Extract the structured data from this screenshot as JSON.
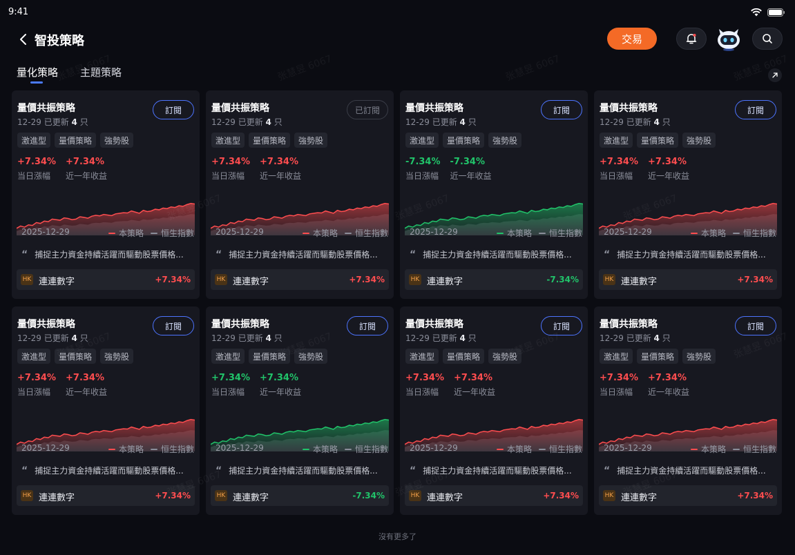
{
  "status_bar": {
    "time": "9:41"
  },
  "header": {
    "title": "智投策略",
    "trade_label": "交易"
  },
  "tabs": [
    {
      "label": "量化策略",
      "active": true
    },
    {
      "label": "主題策略",
      "active": false
    }
  ],
  "colors": {
    "accent": "#4b7bff",
    "up": "#ff4d4f",
    "down": "#21c46a",
    "trade": "#f46a26",
    "hk_badge": "#f3a04a"
  },
  "legend": {
    "strategy": "本策略",
    "index": "恒生指數"
  },
  "cards": [
    {
      "title": "量價共振策略",
      "date": "12-29",
      "updated_label": "已更新",
      "count": "4",
      "unit": "只",
      "subscribe_label": "訂閱",
      "subscribed": false,
      "tags": [
        "激進型",
        "量價策略",
        "強勢股"
      ],
      "daily": "+7.34%",
      "daily_label": "当日漲幅",
      "yearly": "+7.34%",
      "yearly_label": "近一年收益",
      "trend": "up",
      "chart_date": "2025-12-29",
      "desc": "捕捉主力資金持續活躍而驅動股票價格...",
      "stock_market": "HK",
      "stock_name": "連連數字",
      "stock_change": "+7.34%"
    },
    {
      "title": "量價共振策略",
      "date": "12-29",
      "updated_label": "已更新",
      "count": "4",
      "unit": "只",
      "subscribe_label": "已訂閱",
      "subscribed": true,
      "tags": [
        "激進型",
        "量價策略",
        "強勢股"
      ],
      "daily": "+7.34%",
      "daily_label": "当日漲幅",
      "yearly": "+7.34%",
      "yearly_label": "近一年收益",
      "trend": "up",
      "chart_date": "2025-12-29",
      "desc": "捕捉主力資金持續活躍而驅動股票價格...",
      "stock_market": "HK",
      "stock_name": "連連數字",
      "stock_change": "+7.34%"
    },
    {
      "title": "量價共振策略",
      "date": "12-29",
      "updated_label": "已更新",
      "count": "4",
      "unit": "只",
      "subscribe_label": "訂閱",
      "subscribed": false,
      "tags": [
        "激進型",
        "量價策略",
        "強勢股"
      ],
      "daily": "-7.34%",
      "daily_label": "当日漲幅",
      "yearly": "-7.34%",
      "yearly_label": "近一年收益",
      "trend": "down",
      "chart_date": "2025-12-29",
      "desc": "捕捉主力資金持續活躍而驅動股票價格...",
      "stock_market": "HK",
      "stock_name": "連連數字",
      "stock_change": "-7.34%"
    },
    {
      "title": "量價共振策略",
      "date": "12-29",
      "updated_label": "已更新",
      "count": "4",
      "unit": "只",
      "subscribe_label": "訂閱",
      "subscribed": false,
      "tags": [
        "激進型",
        "量價策略",
        "強勢股"
      ],
      "daily": "+7.34%",
      "daily_label": "当日漲幅",
      "yearly": "+7.34%",
      "yearly_label": "近一年收益",
      "trend": "up",
      "chart_date": "2025-12-29",
      "desc": "捕捉主力資金持續活躍而驅動股票價格...",
      "stock_market": "HK",
      "stock_name": "連連數字",
      "stock_change": "+7.34%"
    },
    {
      "title": "量價共振策略",
      "date": "12-29",
      "updated_label": "已更新",
      "count": "4",
      "unit": "只",
      "subscribe_label": "訂閱",
      "subscribed": false,
      "tags": [
        "激進型",
        "量價策略",
        "強勢股"
      ],
      "daily": "+7.34%",
      "daily_label": "当日漲幅",
      "yearly": "+7.34%",
      "yearly_label": "近一年收益",
      "trend": "up",
      "chart_date": "2025-12-29",
      "desc": "捕捉主力資金持續活躍而驅動股票價格...",
      "stock_market": "HK",
      "stock_name": "連連數字",
      "stock_change": "+7.34%"
    },
    {
      "title": "量價共振策略",
      "date": "12-29",
      "updated_label": "已更新",
      "count": "4",
      "unit": "只",
      "subscribe_label": "訂閱",
      "subscribed": false,
      "tags": [
        "激進型",
        "量價策略",
        "強勢股"
      ],
      "daily": "+7.34%",
      "daily_label": "当日漲幅",
      "yearly": "+7.34%",
      "yearly_label": "近一年收益",
      "trend": "down",
      "chart_date": "2025-12-29",
      "desc": "捕捉主力資金持續活躍而驅動股票價格...",
      "stock_market": "HK",
      "stock_name": "連連數字",
      "stock_change": "-7.34%"
    },
    {
      "title": "量價共振策略",
      "date": "12-29",
      "updated_label": "已更新",
      "count": "4",
      "unit": "只",
      "subscribe_label": "訂閱",
      "subscribed": false,
      "tags": [
        "激進型",
        "量價策略",
        "強勢股"
      ],
      "daily": "+7.34%",
      "daily_label": "当日漲幅",
      "yearly": "+7.34%",
      "yearly_label": "近一年收益",
      "trend": "up",
      "chart_date": "2025-12-29",
      "desc": "捕捉主力資金持續活躍而驅動股票價格...",
      "stock_market": "HK",
      "stock_name": "連連數字",
      "stock_change": "+7.34%"
    },
    {
      "title": "量價共振策略",
      "date": "12-29",
      "updated_label": "已更新",
      "count": "4",
      "unit": "只",
      "subscribe_label": "訂閱",
      "subscribed": false,
      "tags": [
        "激進型",
        "量價策略",
        "強勢股"
      ],
      "daily": "+7.34%",
      "daily_label": "当日漲幅",
      "yearly": "+7.34%",
      "yearly_label": "近一年收益",
      "trend": "up",
      "chart_date": "2025-12-29",
      "desc": "捕捉主力資金持續活躍而驅動股票價格...",
      "stock_market": "HK",
      "stock_name": "連連數字",
      "stock_change": "+7.34%"
    }
  ],
  "footer": {
    "no_more": "沒有更多了"
  },
  "watermark": {
    "text": "张慧昱 6067"
  },
  "icons": {
    "back": "chevron-left-icon",
    "bell": "bell-icon",
    "search": "search-icon",
    "expand": "arrow-up-right-icon",
    "mascot": "robot-mascot-icon"
  }
}
